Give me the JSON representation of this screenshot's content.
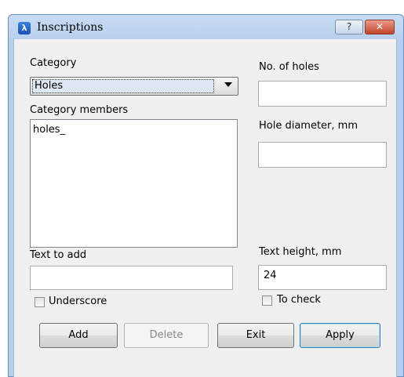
{
  "window": {
    "title": "Inscriptions",
    "help_label": "?",
    "close_label": "✕"
  },
  "form": {
    "category_label": "Category",
    "category_value": "Holes",
    "members_label": "Category members",
    "members": [
      "holes_"
    ],
    "text_to_add_label": "Text to add",
    "text_to_add_value": "",
    "underscore_label": "Underscore",
    "underscore_checked": false,
    "num_holes_label": "No. of holes",
    "num_holes_value": "",
    "hole_diameter_label": "Hole diameter, mm",
    "hole_diameter_value": "",
    "text_height_label": "Text height, mm",
    "text_height_value": "24",
    "to_check_label": "To check",
    "to_check_checked": false
  },
  "buttons": {
    "add": "Add",
    "delete": "Delete",
    "exit": "Exit",
    "apply": "Apply"
  }
}
